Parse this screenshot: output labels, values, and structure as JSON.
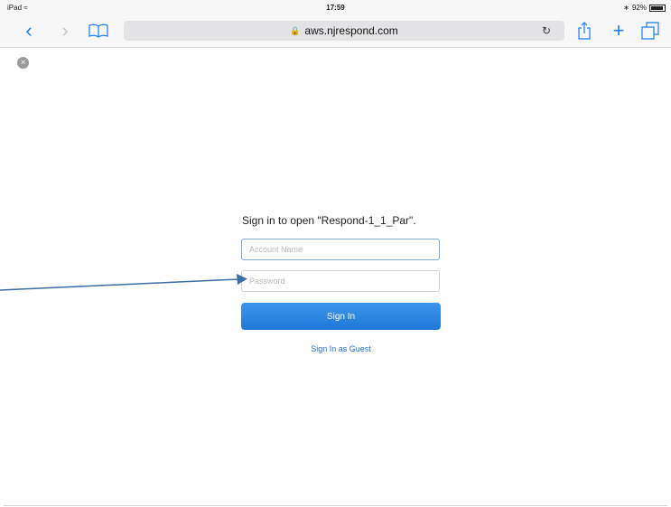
{
  "status": {
    "device": "iPad",
    "time": "17:59",
    "battery_text": "92%",
    "battery_level": 0.92
  },
  "browser": {
    "url": "aws.njrespond.com"
  },
  "login": {
    "prompt": "Sign in to open \"Respond-1_1_Par\".",
    "account_placeholder": "Account Name",
    "password_placeholder": "Password",
    "signin_label": "Sign In",
    "guest_label": "Sign In as Guest"
  },
  "colors": {
    "accent": "#1a7bf2",
    "annotation_arrow": "#3b6fa8"
  }
}
